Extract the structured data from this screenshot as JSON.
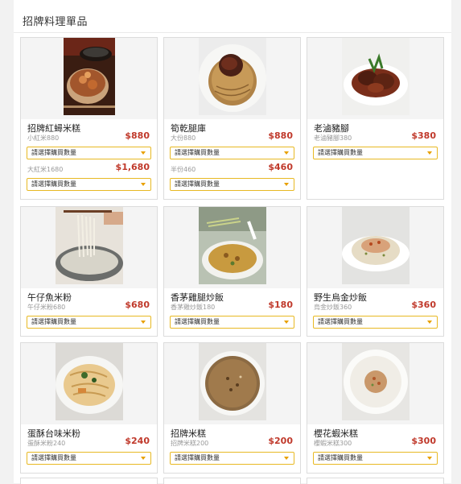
{
  "section": {
    "title": "招牌料理單品"
  },
  "select_placeholder": "請選擇購買數量",
  "items": [
    {
      "name": "招牌紅蟳米糕",
      "variants": [
        {
          "label": "小紅米880",
          "price": "$880"
        },
        {
          "label": "大紅米1680",
          "price": "$1,680"
        }
      ]
    },
    {
      "name": "筍乾腿庫",
      "variants": [
        {
          "label": "大份880",
          "price": "$880"
        },
        {
          "label": "半份460",
          "price": "$460"
        }
      ]
    },
    {
      "name": "老滷豬腳",
      "variants": [
        {
          "label": "老滷豬腳380",
          "price": "$380"
        }
      ]
    },
    {
      "name": "午仔魚米粉",
      "variants": [
        {
          "label": "午仔米粉680",
          "price": "$680"
        }
      ]
    },
    {
      "name": "香茅雞腿炒飯",
      "variants": [
        {
          "label": "香茅雞炒飯180",
          "price": "$180"
        }
      ]
    },
    {
      "name": "野生烏金炒飯",
      "variants": [
        {
          "label": "烏金炒飯360",
          "price": "$360"
        }
      ]
    },
    {
      "name": "蛋酥台味米粉",
      "variants": [
        {
          "label": "蛋酥米粉240",
          "price": "$240"
        }
      ]
    },
    {
      "name": "招牌米糕",
      "variants": [
        {
          "label": "招牌米糕200",
          "price": "$200"
        }
      ]
    },
    {
      "name": "櫻花蝦米糕",
      "variants": [
        {
          "label": "櫻蝦米糕300",
          "price": "$300"
        }
      ]
    }
  ]
}
